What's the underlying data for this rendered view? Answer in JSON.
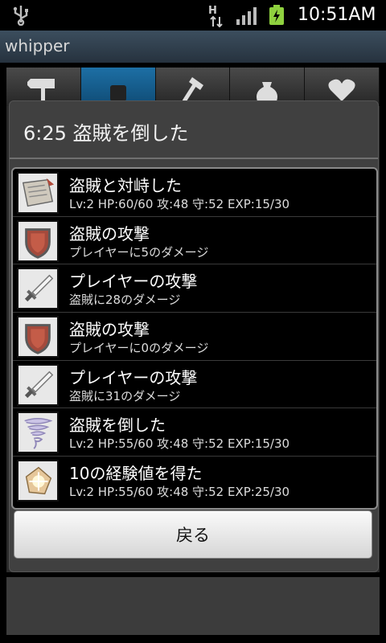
{
  "status_bar": {
    "time": "10:51AM",
    "network_type": "H",
    "icons": [
      "usb-icon",
      "hsdpa-icon",
      "signal-icon",
      "battery-charging-icon"
    ]
  },
  "app": {
    "title": "whipper"
  },
  "tabs": [
    {
      "icon": "signpost-icon"
    },
    {
      "icon": "square-icon"
    },
    {
      "icon": "hammer-icon"
    },
    {
      "icon": "money-bag-icon"
    },
    {
      "icon": "heart-icon"
    }
  ],
  "dialog": {
    "title": "6:25 盗賊を倒した",
    "log": [
      {
        "icon": "scroll-icon",
        "text": "盗賊と対峙した",
        "detail": "Lv:2 HP:60/60 攻:48 守:52 EXP:15/30"
      },
      {
        "icon": "shield-icon",
        "text": "盗賊の攻撃",
        "detail": "プレイヤーに5のダメージ"
      },
      {
        "icon": "sword-icon",
        "text": "プレイヤーの攻撃",
        "detail": "盗賊に28のダメージ"
      },
      {
        "icon": "shield-icon",
        "text": "盗賊の攻撃",
        "detail": "プレイヤーに0のダメージ"
      },
      {
        "icon": "sword-icon",
        "text": "プレイヤーの攻撃",
        "detail": "盗賊に31のダメージ"
      },
      {
        "icon": "tornado-icon",
        "text": "盗賊を倒した",
        "detail": "Lv:2 HP:55/60 攻:48 守:52 EXP:15/30"
      },
      {
        "icon": "sparkle-icon",
        "text": "10の経験値を得た",
        "detail": "Lv:2 HP:55/60 攻:48 守:52 EXP:25/30"
      }
    ],
    "back_label": "戻る"
  }
}
